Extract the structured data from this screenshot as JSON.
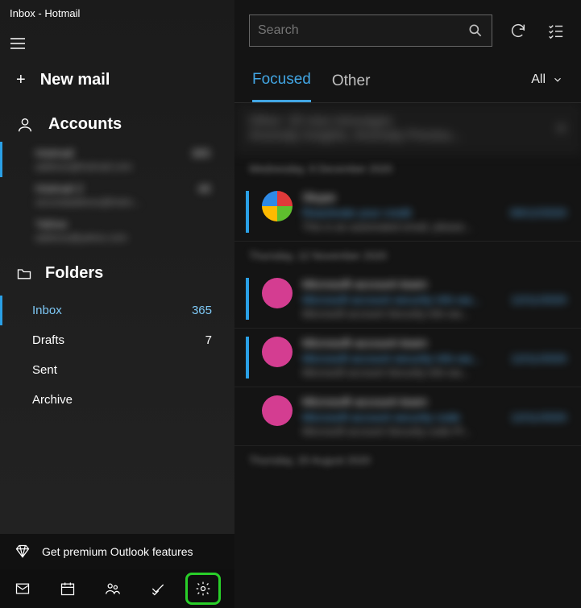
{
  "window": {
    "title": "Inbox - Hotmail"
  },
  "sidebar": {
    "new_mail": "New mail",
    "accounts_label": "Accounts",
    "accounts": [
      {
        "name": "Hotmail",
        "email": "address@hotmail.com",
        "badge": "365"
      },
      {
        "name": "Hotmail 2",
        "email": "secondaddress@hotm...",
        "badge": "48"
      },
      {
        "name": "Yahoo",
        "email": "address@yahoo.com",
        "badge": ""
      }
    ],
    "folders_label": "Folders",
    "folders": [
      {
        "name": "Inbox",
        "count": "365",
        "active": true
      },
      {
        "name": "Drafts",
        "count": "7",
        "active": false
      },
      {
        "name": "Sent",
        "count": "",
        "active": false
      },
      {
        "name": "Archive",
        "count": "",
        "active": false
      }
    ],
    "premium": "Get premium Outlook features"
  },
  "toolbar": {
    "search_placeholder": "Search",
    "tabs": {
      "focused": "Focused",
      "other": "Other"
    },
    "filter_label": "All"
  },
  "messages": {
    "summary": {
      "line1": "Other: 20 new messages",
      "line2": "Anomaly Insights, Anomaly Previou..."
    },
    "groups": [
      {
        "label": "Wednesday, 9 December 2020",
        "items": [
          {
            "avatar": "multi",
            "sender": "Skype",
            "subject": "Reactivate your credit",
            "date": "09/12/2020",
            "preview": "This is an automated email, please..."
          }
        ]
      },
      {
        "label": "Thursday, 12 November 2020",
        "items": [
          {
            "avatar": "pink",
            "sender": "Microsoft account team",
            "subject": "Microsoft account security info wa...",
            "date": "12/11/2020",
            "preview": "Microsoft account Security info wa..."
          },
          {
            "avatar": "pink",
            "sender": "Microsoft account team",
            "subject": "Microsoft account security info wa...",
            "date": "12/11/2020",
            "preview": "Microsoft account Security info wa..."
          },
          {
            "avatar": "pink",
            "sender": "Microsoft account team",
            "subject": "Microsoft account security code",
            "date": "12/11/2020",
            "preview": "Microsoft account Security code Pl..."
          }
        ]
      },
      {
        "label": "Thursday, 20 August 2020",
        "items": []
      }
    ]
  }
}
